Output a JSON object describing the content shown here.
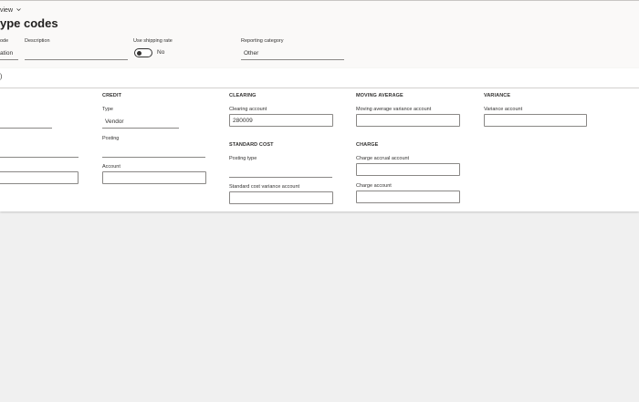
{
  "header": {
    "view_label": "view",
    "title": "ype codes",
    "code_label": "ode",
    "code_value": "ation",
    "description_label": "Description",
    "description_value": "",
    "use_shipping_rate_label": "Use shipping rate",
    "use_shipping_rate_value": "No",
    "use_shipping_rate_on": false,
    "reporting_category_label": "Reporting category",
    "reporting_category_value": "Other"
  },
  "panel": {
    "tab_mark": ")",
    "credit": {
      "title": "CREDIT",
      "type_label": "Type",
      "type_value": "Vendor",
      "posting_label": "Posting",
      "posting_value": "",
      "account_label": "Account",
      "account_value": ""
    },
    "clearing": {
      "title": "CLEARING",
      "clearing_account_label": "Clearing account",
      "clearing_account_value": "280009"
    },
    "standard_cost": {
      "title": "STANDARD COST",
      "posting_type_label": "Posting type",
      "posting_type_value": "",
      "variance_account_label": "Standard cost variance account",
      "variance_account_value": ""
    },
    "moving_average": {
      "title": "MOVING AVERAGE",
      "variance_account_label": "Moving average variance account",
      "variance_account_value": ""
    },
    "charge": {
      "title": "CHARGE",
      "accrual_label": "Charge accrual account",
      "accrual_value": "",
      "account_label": "Charge account",
      "account_value": ""
    },
    "variance": {
      "title": "VARIANCE",
      "variance_account_label": "Variance account",
      "variance_account_value": ""
    }
  }
}
